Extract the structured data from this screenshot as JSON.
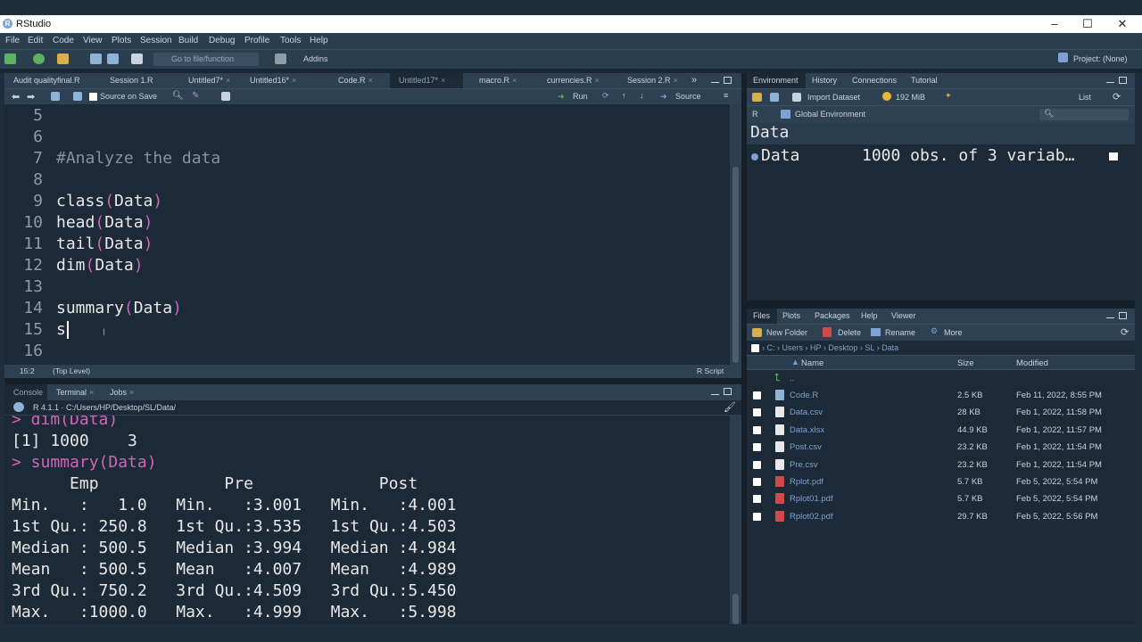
{
  "window": {
    "title": "RStudio",
    "controls": [
      "–",
      "☐",
      "✕"
    ]
  },
  "menu": [
    "File",
    "Edit",
    "Code",
    "View",
    "Plots",
    "Session",
    "Build",
    "Debug",
    "Profile",
    "Tools",
    "Help"
  ],
  "toolbar": {
    "goto_placeholder": "Go to file/function",
    "addins": "Addins",
    "project": "Project: (None)"
  },
  "editor": {
    "tabs": [
      "Audit qualityfinal.R",
      "Session 1.R",
      "Untitled7*",
      "Untitled16*",
      "Code.R",
      "Untitled17*",
      "macro.R",
      "currencies.R",
      "Session 2.R"
    ],
    "active_tab_index": 5,
    "source_on_save": "Source on Save",
    "run": "Run",
    "source": "Source",
    "lines": [
      {
        "n": "5",
        "code": ""
      },
      {
        "n": "6",
        "code": ""
      },
      {
        "n": "7",
        "code": "#Analyze the data",
        "type": "comment"
      },
      {
        "n": "8",
        "code": ""
      },
      {
        "n": "9",
        "fn": "class",
        "arg": "Data"
      },
      {
        "n": "10",
        "fn": "head",
        "arg": "Data"
      },
      {
        "n": "11",
        "fn": "tail",
        "arg": "Data"
      },
      {
        "n": "12",
        "fn": "dim",
        "arg": "Data"
      },
      {
        "n": "13",
        "code": ""
      },
      {
        "n": "14",
        "fn": "summary",
        "arg": "Data"
      },
      {
        "n": "15",
        "code": "s",
        "cursor": true
      },
      {
        "n": "16",
        "code": ""
      }
    ],
    "status_pos": "15:2",
    "status_scope": "(Top Level)",
    "status_type": "R Script"
  },
  "console": {
    "tabs": [
      "Console",
      "Terminal",
      "Jobs"
    ],
    "path": "R 4.1.1 · C:/Users/HP/Desktop/SL/Data/",
    "lines": [
      {
        "text": "> dim(Data)",
        "prompt": true
      },
      {
        "text": "[1] 1000    3"
      },
      {
        "text": "> summary(Data)",
        "prompt": true
      },
      {
        "text": "      Emp             Pre             Post      "
      },
      {
        "text": "Min.   :   1.0   Min.   :3.001   Min.   :4.001  "
      },
      {
        "text": "1st Qu.: 250.8   1st Qu.:3.535   1st Qu.:4.503  "
      },
      {
        "text": "Median : 500.5   Median :3.994   Median :4.984  "
      },
      {
        "text": "Mean   : 500.5   Mean   :4.007   Mean   :4.989  "
      },
      {
        "text": "3rd Qu.: 750.2   3rd Qu.:4.509   3rd Qu.:5.450  "
      },
      {
        "text": "Max.   :1000.0   Max.   :4.999   Max.   :5.998  "
      }
    ]
  },
  "environment": {
    "tabs": [
      "Environment",
      "History",
      "Connections",
      "Tutorial"
    ],
    "import_dataset": "Import Dataset",
    "memory": "192 MiB",
    "view_mode": "List",
    "lang": "R",
    "scope": "Global Environment",
    "section": "Data",
    "var_name": "Data",
    "var_desc": "1000 obs. of 3 variab…"
  },
  "files": {
    "tabs": [
      "Files",
      "Plots",
      "Packages",
      "Help",
      "Viewer"
    ],
    "new_folder": "New Folder",
    "delete": "Delete",
    "rename": "Rename",
    "more": "More",
    "breadcrumb": [
      "C:",
      "Users",
      "HP",
      "Desktop",
      "SL",
      "Data"
    ],
    "cols": {
      "name": "Name",
      "size": "Size",
      "modified": "Modified"
    },
    "up": "..",
    "rows": [
      {
        "name": "Code.R",
        "size": "2.5 KB",
        "modified": "Feb 11, 2022, 8:55 PM",
        "kind": "r"
      },
      {
        "name": "Data.csv",
        "size": "28 KB",
        "modified": "Feb 1, 2022, 11:58 PM",
        "kind": "doc"
      },
      {
        "name": "Data.xlsx",
        "size": "44.9 KB",
        "modified": "Feb 1, 2022, 11:57 PM",
        "kind": "doc"
      },
      {
        "name": "Post.csv",
        "size": "23.2 KB",
        "modified": "Feb 1, 2022, 11:54 PM",
        "kind": "doc"
      },
      {
        "name": "Pre.csv",
        "size": "23.2 KB",
        "modified": "Feb 1, 2022, 11:54 PM",
        "kind": "doc"
      },
      {
        "name": "Rplot.pdf",
        "size": "5.7 KB",
        "modified": "Feb 5, 2022, 5:54 PM",
        "kind": "pdf"
      },
      {
        "name": "Rplot01.pdf",
        "size": "5.7 KB",
        "modified": "Feb 5, 2022, 5:54 PM",
        "kind": "pdf"
      },
      {
        "name": "Rplot02.pdf",
        "size": "29.7 KB",
        "modified": "Feb 5, 2022, 5:56 PM",
        "kind": "pdf"
      }
    ]
  },
  "colors": {
    "accent": "#d166b7",
    "background": "#1c2936",
    "panel": "#2d4153"
  }
}
